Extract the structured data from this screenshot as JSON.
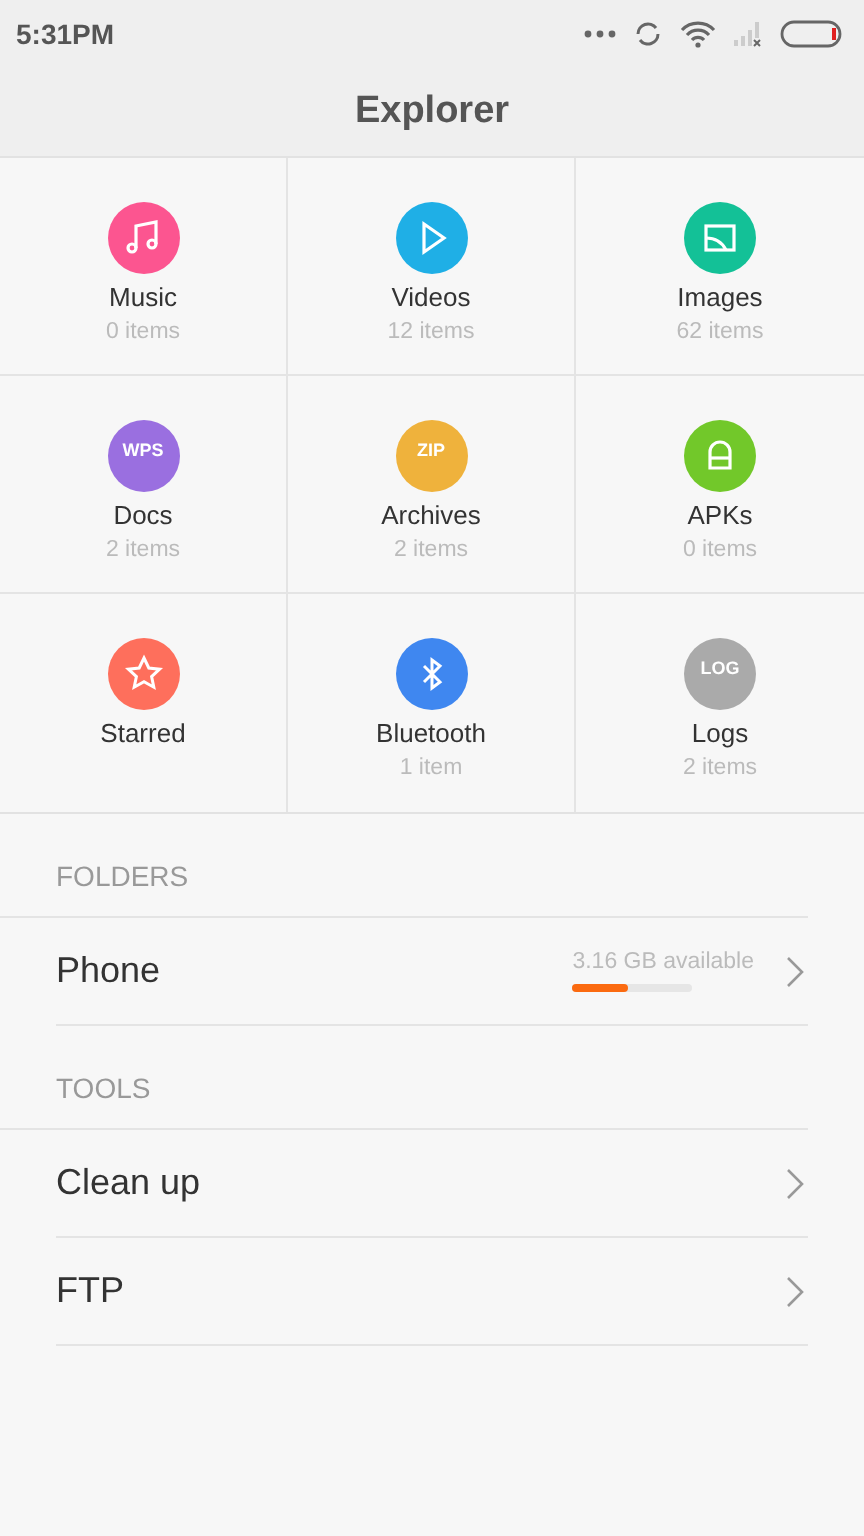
{
  "status_bar": {
    "time": "5:31PM"
  },
  "title": "Explorer",
  "categories": [
    {
      "label": "Music",
      "count": "0 items",
      "color": "#fc5590",
      "kind": "music"
    },
    {
      "label": "Videos",
      "count": "12 items",
      "color": "#1fafe6",
      "kind": "video"
    },
    {
      "label": "Images",
      "count": "62 items",
      "color": "#13c197",
      "kind": "image"
    },
    {
      "label": "Docs",
      "count": "2 items",
      "color": "#9a6fe0",
      "kind": "badge",
      "badge": "WPS"
    },
    {
      "label": "Archives",
      "count": "2 items",
      "color": "#efb23c",
      "kind": "badge",
      "badge": "ZIP"
    },
    {
      "label": "APKs",
      "count": "0 items",
      "color": "#72c82a",
      "kind": "apk"
    },
    {
      "label": "Starred",
      "color": "#fe6f5c",
      "kind": "star"
    },
    {
      "label": "Bluetooth",
      "count": "1 item",
      "color": "#3f87f0",
      "kind": "bluetooth"
    },
    {
      "label": "Logs",
      "count": "2 items",
      "color": "#aaaaaa",
      "kind": "badge",
      "badge": "LOG"
    }
  ],
  "sections": [
    {
      "heading": "FOLDERS",
      "rows": [
        {
          "label": "Phone",
          "storage": {
            "reading": "3.16 GB available",
            "level": 0.47
          }
        }
      ]
    },
    {
      "heading": "TOOLS",
      "rows": [
        {
          "label": "Clean up"
        },
        {
          "label": "FTP"
        }
      ]
    }
  ]
}
